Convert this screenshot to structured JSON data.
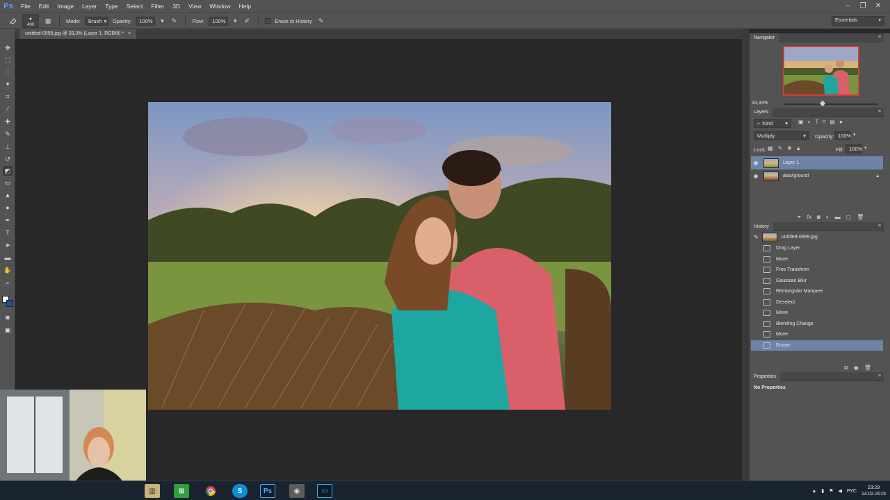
{
  "app": {
    "logo": "Ps"
  },
  "menu": [
    "File",
    "Edit",
    "Image",
    "Layer",
    "Type",
    "Select",
    "Filter",
    "3D",
    "View",
    "Window",
    "Help"
  ],
  "window_controls": {
    "minimize": "–",
    "restore": "❐",
    "close": "✕"
  },
  "options": {
    "brush_size": "400",
    "mode_label": "Mode:",
    "mode_value": "Brush",
    "opacity_label": "Opacity:",
    "opacity_value": "100%",
    "flow_label": "Flow:",
    "flow_value": "100%",
    "erase_history_label": "Erase to History",
    "workspace": "Essentials"
  },
  "document": {
    "tab_title": "untitled-0999.jpg @ 33,3% (Layer 1, RGB/8) *",
    "tab_close": "×"
  },
  "navigator": {
    "title": "Navigator",
    "zoom": "33,33%"
  },
  "layers": {
    "title": "Layers",
    "filter_kind": "Kind",
    "blend_mode": "Multiply",
    "opacity_label": "Opacity:",
    "opacity_value": "100%",
    "lock_label": "Lock:",
    "fill_label": "Fill:",
    "fill_value": "100%",
    "items": [
      {
        "name": "Layer 1",
        "selected": true
      },
      {
        "name": "Background",
        "selected": false
      }
    ]
  },
  "history": {
    "title": "History",
    "snapshot": "untitled-0999.jpg",
    "items": [
      "Drag Layer",
      "Move",
      "Free Transform",
      "Gaussian Blur",
      "Rectangular Marquee",
      "Deselect",
      "Move",
      "Blending Change",
      "Move",
      "Eraser"
    ],
    "selected_index": 9
  },
  "properties": {
    "title": "Properties",
    "content": "No Properties"
  },
  "taskbar": {
    "language": "РУС",
    "time": "23:29",
    "date": "14.02.2015"
  },
  "colors": {
    "selection": "#6d84a8",
    "panel_bg": "#535353",
    "canvas_bg": "#282828",
    "taskbar": "#1a2431"
  }
}
